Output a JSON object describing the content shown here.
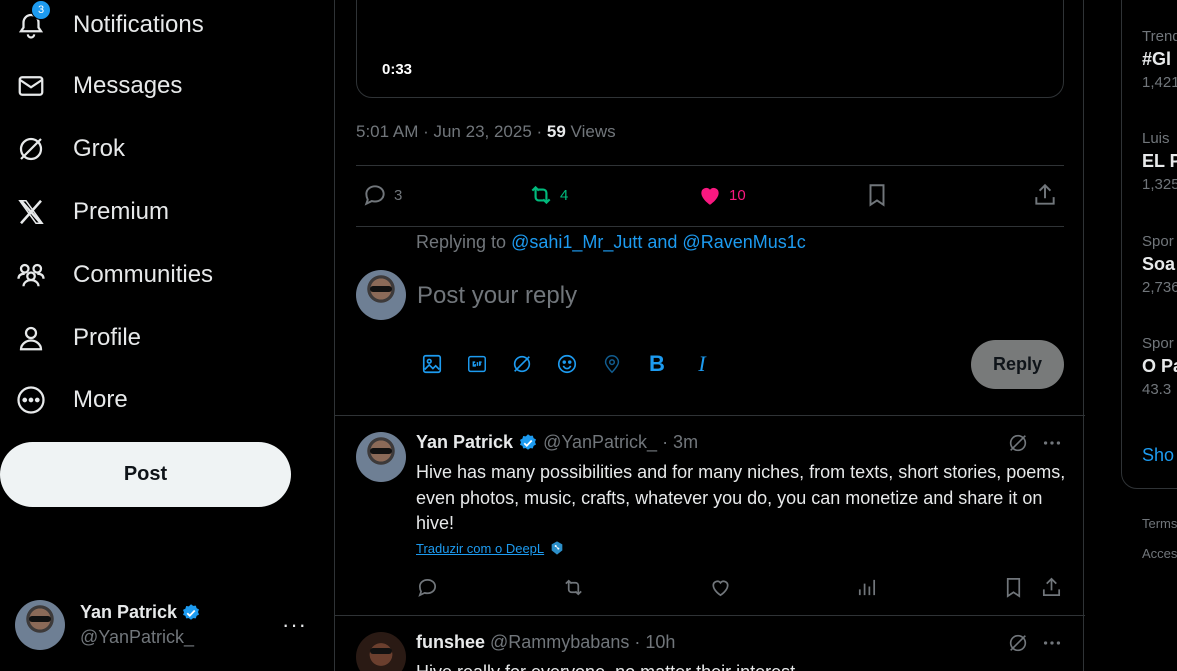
{
  "nav": {
    "items": [
      {
        "label": "Notifications",
        "icon": "bell-icon",
        "badge": "3"
      },
      {
        "label": "Messages",
        "icon": "mail-icon"
      },
      {
        "label": "Grok",
        "icon": "grok-icon"
      },
      {
        "label": "Premium",
        "icon": "x-logo-icon"
      },
      {
        "label": "Communities",
        "icon": "people-icon"
      },
      {
        "label": "Profile",
        "icon": "person-icon"
      },
      {
        "label": "More",
        "icon": "more-circle-icon"
      }
    ],
    "post_label": "Post"
  },
  "account": {
    "name": "Yan Patrick",
    "handle": "@YanPatrick_",
    "more": "···"
  },
  "main_post": {
    "video_time": "0:33",
    "timestamp": "5:01 AM · Jun 23, 2025 · ",
    "views_count": "59",
    "views_label": " Views",
    "replies": "3",
    "retweets": "4",
    "likes": "10"
  },
  "composer": {
    "replying_prefix": "Replying to ",
    "replying_to": "@sahi1_Mr_Jutt and @RavenMus1c",
    "placeholder": "Post your reply",
    "reply_label": "Reply",
    "bold_label": "B",
    "italic_label": "I"
  },
  "replies": [
    {
      "name": "Yan Patrick",
      "handle": "@YanPatrick_",
      "time": "· 3m",
      "text": "Hive has many possibilities and for many niches, from texts, short stories, poems, even photos, music, crafts, whatever you do, you can monetize and share it on hive!",
      "translate": "Traduzir com o DeepL"
    },
    {
      "name": "funshee",
      "handle": "@Rammybabans",
      "time": "· 10h",
      "text": "Hive really for everyone, no matter their interest"
    }
  ],
  "trends": [
    {
      "meta": "Trending",
      "title": "#Gl",
      "count": "1,421"
    },
    {
      "meta": "Luis",
      "title": "EL P",
      "count": "1,325"
    },
    {
      "meta": "Spor",
      "title": "Soa",
      "count": "2,736"
    },
    {
      "meta": "Spor",
      "title": "O Pa",
      "count": "43.3"
    }
  ],
  "show_more": "Sho",
  "footer": [
    "Terms",
    "Acces"
  ],
  "colors": {
    "accent": "#1d9bf0",
    "like": "#f91880",
    "retweet": "#00ba7c",
    "border": "#2f3336",
    "muted": "#71767b"
  }
}
